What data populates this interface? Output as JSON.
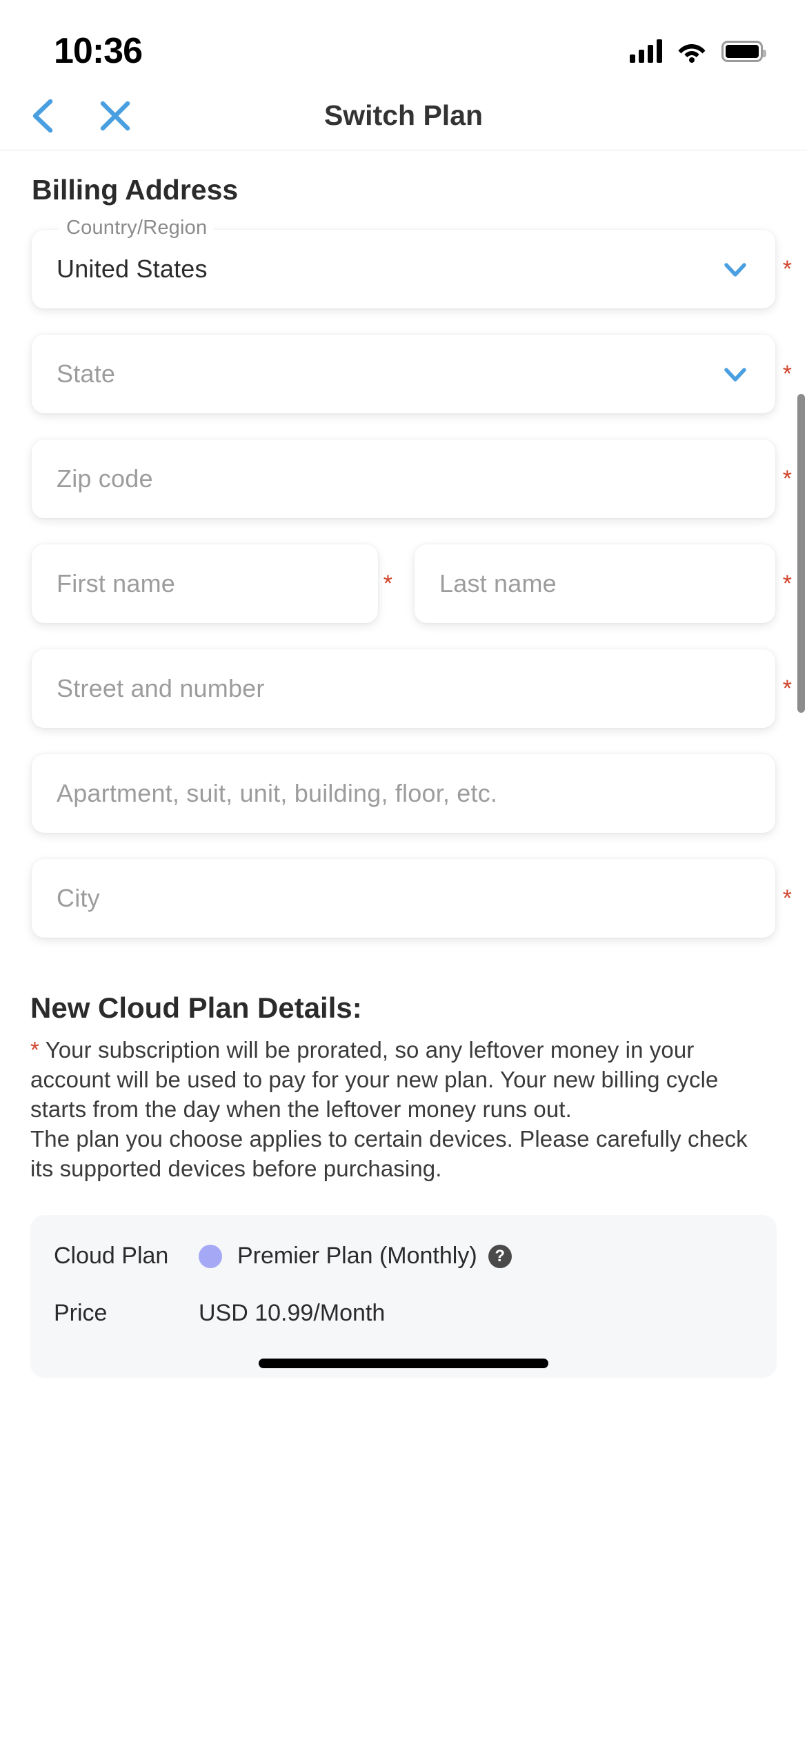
{
  "status_bar": {
    "time": "10:36",
    "signal_icon": "cellular-signal-icon",
    "wifi_icon": "wifi-icon",
    "battery_icon": "battery-icon"
  },
  "nav": {
    "back_icon": "chevron-left-icon",
    "close_icon": "close-x-icon",
    "title": "Switch Plan",
    "accent_color": "#4a9fe0"
  },
  "billing": {
    "heading": "Billing Address",
    "required_marker": "*",
    "required_color": "#d0422a",
    "fields": [
      {
        "name": "country",
        "label": "Country/Region",
        "value": "United States",
        "placeholder": "",
        "type": "select",
        "required": true
      },
      {
        "name": "state",
        "label": "",
        "value": "",
        "placeholder": "State",
        "type": "select",
        "required": true
      },
      {
        "name": "zip",
        "label": "",
        "value": "",
        "placeholder": "Zip code",
        "type": "text",
        "required": true
      },
      {
        "name": "first_name",
        "label": "",
        "value": "",
        "placeholder": "First name",
        "type": "text",
        "required": true
      },
      {
        "name": "last_name",
        "label": "",
        "value": "",
        "placeholder": "Last name",
        "type": "text",
        "required": true
      },
      {
        "name": "street",
        "label": "",
        "value": "",
        "placeholder": "Street and number",
        "type": "text",
        "required": true
      },
      {
        "name": "apartment",
        "label": "",
        "value": "",
        "placeholder": "Apartment, suit, unit, building, floor, etc.",
        "type": "text",
        "required": false
      },
      {
        "name": "city",
        "label": "",
        "value": "",
        "placeholder": "City",
        "type": "text",
        "required": true
      }
    ]
  },
  "plan_details": {
    "heading": "New Cloud Plan Details:",
    "note_star": "*",
    "note_1": " Your subscription will be prorated, so any leftover money in your account will be used to pay for your new plan. Your new billing cycle starts from the day when the leftover money runs out.",
    "note_2": "The plan you choose applies to certain devices. Please carefully check its supported devices before purchasing.",
    "card": {
      "rows": [
        {
          "key": "Cloud Plan",
          "value": "Premier Plan (Monthly)",
          "dot_color": "#a5a8f5",
          "has_help": true
        },
        {
          "key": "Price",
          "value": "USD 10.99/Month",
          "dot_color": "",
          "has_help": false
        }
      ],
      "help_glyph": "?"
    }
  }
}
